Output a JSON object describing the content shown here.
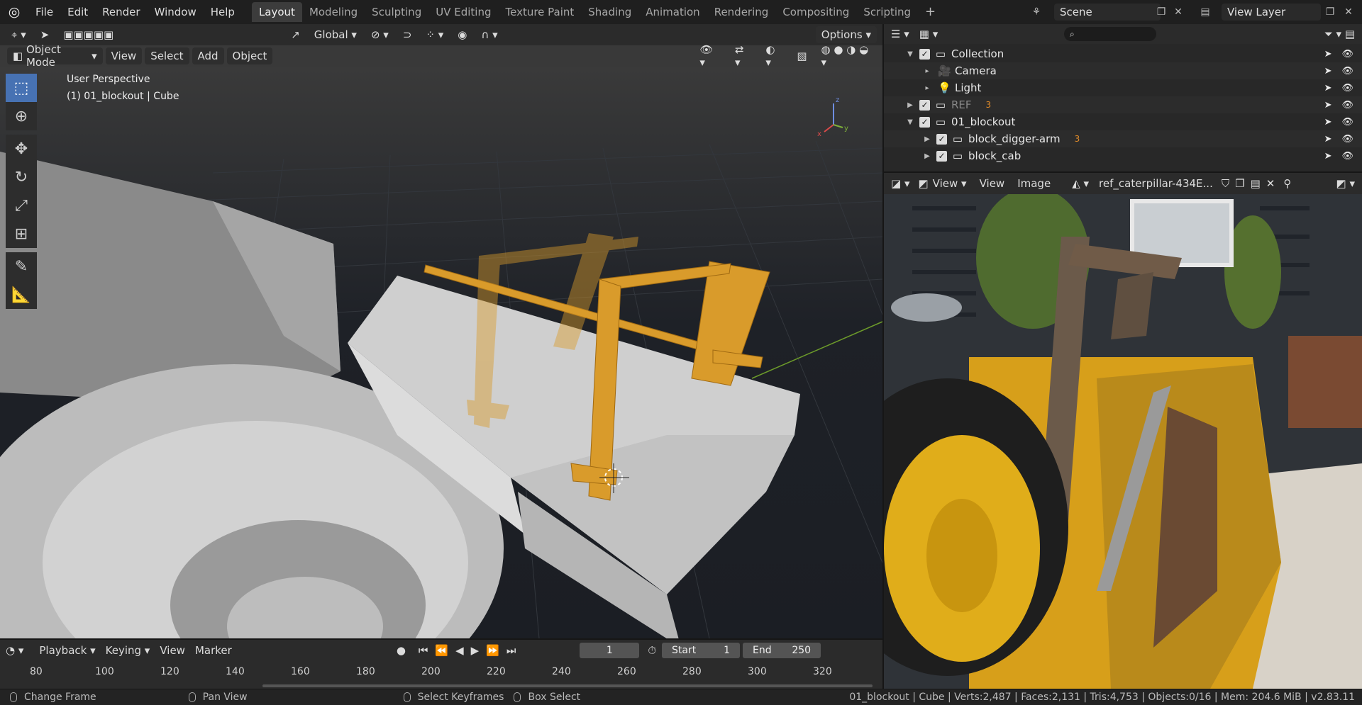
{
  "menu": [
    "File",
    "Edit",
    "Render",
    "Window",
    "Help"
  ],
  "workspaces": [
    "Layout",
    "Modeling",
    "Sculpting",
    "UV Editing",
    "Texture Paint",
    "Shading",
    "Animation",
    "Rendering",
    "Compositing",
    "Scripting"
  ],
  "active_workspace": "Layout",
  "scene": "Scene",
  "view_layer": "View Layer",
  "viewport": {
    "transform_orientation": "Global",
    "options_label": "Options",
    "mode": "Object Mode",
    "menus": [
      "View",
      "Select",
      "Add",
      "Object"
    ],
    "perspective": "User Perspective",
    "active_object": "(1) 01_blockout | Cube",
    "gizmo_axes": {
      "x": "x",
      "y": "y",
      "z": "z"
    }
  },
  "outliner": {
    "rows": [
      {
        "name": "Collection",
        "depth": 1,
        "type": "collection",
        "expanded": true,
        "checked": true
      },
      {
        "name": "Camera",
        "depth": 2,
        "type": "camera"
      },
      {
        "name": "Light",
        "depth": 2,
        "type": "light"
      },
      {
        "name": "REF",
        "depth": 1,
        "type": "collection",
        "expanded": false,
        "checked": true,
        "dim": true,
        "badge": "3"
      },
      {
        "name": "01_blockout",
        "depth": 1,
        "type": "collection",
        "expanded": true,
        "checked": true
      },
      {
        "name": "block_digger-arm",
        "depth": 2,
        "type": "collection",
        "checked": true,
        "badge": "3"
      },
      {
        "name": "block_cab",
        "depth": 2,
        "type": "collection",
        "checked": true
      }
    ]
  },
  "image_editor": {
    "menus": [
      "View",
      "View",
      "Image"
    ],
    "image_name": "ref_caterpillar-434E..."
  },
  "timeline": {
    "menus": [
      "Playback",
      "Keying",
      "View",
      "Marker"
    ],
    "current_frame": "1",
    "start_label": "Start",
    "start": "1",
    "end_label": "End",
    "end": "250",
    "ticks": [
      "80",
      "100",
      "120",
      "140",
      "160",
      "180",
      "200",
      "220",
      "240",
      "260",
      "280",
      "300",
      "320"
    ]
  },
  "status": {
    "left": [
      "Change Frame",
      "Pan View",
      "Select Keyframes",
      "Box Select"
    ],
    "right": "01_blockout | Cube | Verts:2,487 | Faces:2,131 | Tris:4,753 | Objects:0/16 | Mem: 204.6 MiB | v2.83.11"
  },
  "colors": {
    "accent": "#4772b3",
    "orange": "#d99b2b",
    "background": "#1f1f1f"
  }
}
